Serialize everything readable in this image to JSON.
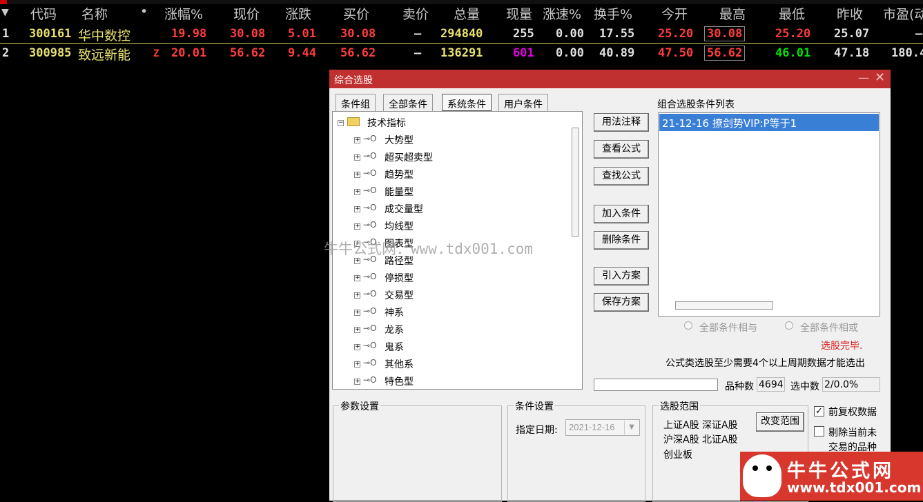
{
  "header": {
    "cols": [
      "代码",
      "名称",
      "•",
      "涨幅%",
      "现价",
      "涨跌",
      "买价",
      "卖价",
      "总量",
      "现量",
      "涨速%",
      "换手%",
      "今开",
      "最高",
      "最低",
      "昨收",
      "市盈(动"
    ]
  },
  "rows": [
    {
      "idx": "1",
      "code": "300161",
      "name": "华中数控",
      "flag": "",
      "pct": "19.98",
      "price": "30.08",
      "chg": "5.01",
      "bid": "30.08",
      "ask": "—",
      "vol": "294840",
      "cur": "255",
      "speed": "0.00",
      "turn": "17.55",
      "open": "25.20",
      "high": "30.08",
      "low": "25.20",
      "prev": "25.07",
      "pe": "—"
    },
    {
      "idx": "2",
      "code": "300985",
      "name": "致远新能",
      "flag": "Z",
      "pct": "20.01",
      "price": "56.62",
      "chg": "9.44",
      "bid": "56.62",
      "ask": "—",
      "vol": "136291",
      "cur": "601",
      "speed": "0.00",
      "turn": "40.89",
      "open": "47.50",
      "high": "56.62",
      "low": "46.01",
      "prev": "47.18",
      "pe": "180.4"
    }
  ],
  "dialog": {
    "title": "综合选股",
    "tabs": [
      "条件组",
      "全部条件",
      "系统条件",
      "用户条件"
    ],
    "tree_root": "技术指标",
    "tree_items": [
      "大势型",
      "超买超卖型",
      "趋势型",
      "能量型",
      "成交量型",
      "均线型",
      "图表型",
      "路径型",
      "停损型",
      "交易型",
      "神系",
      "龙系",
      "鬼系",
      "其他系",
      "特色型"
    ],
    "buttons": {
      "usage": "用法注释",
      "view_formula": "查看公式",
      "find_formula": "查找公式",
      "add_cond": "加入条件",
      "del_cond": "删除条件",
      "import_plan": "引入方案",
      "save_plan": "保存方案",
      "change_range": "改变范围"
    },
    "list_title": "组合选股条件列表",
    "list_items": [
      "21-12-16 撩剑势VIP:P等于1"
    ],
    "radio_and": "全部条件相与",
    "radio_or": "全部条件相或",
    "status": "选股完毕.",
    "note": "公式类选股至少需要4个以上周期数据才能选出",
    "count_label": "品种数",
    "count_value": "4694",
    "selected_label": "选中数",
    "selected_value": "2/0.0%",
    "param_title": "参数设置",
    "cond_title": "条件设置",
    "date_label": "指定日期:",
    "date_value": "2021-12-16",
    "range_title": "选股范围",
    "range_lines": [
      "上证A股 深证A股",
      "沪深A股 北证A股",
      "创业板"
    ],
    "chk_adjust": "前复权数据",
    "chk_exclude_1": "剔除当前未",
    "chk_exclude_2": "交易的品种"
  },
  "watermark": "牛牛公式网：www.tdx001.com",
  "brand": {
    "name": "牛牛公式网",
    "url": "www.tdx001.com"
  },
  "colors": {
    "rise": "#ff3c3c",
    "name": "#e8e070",
    "dialog_title": "#c03030",
    "selection": "#3a7fd6"
  }
}
